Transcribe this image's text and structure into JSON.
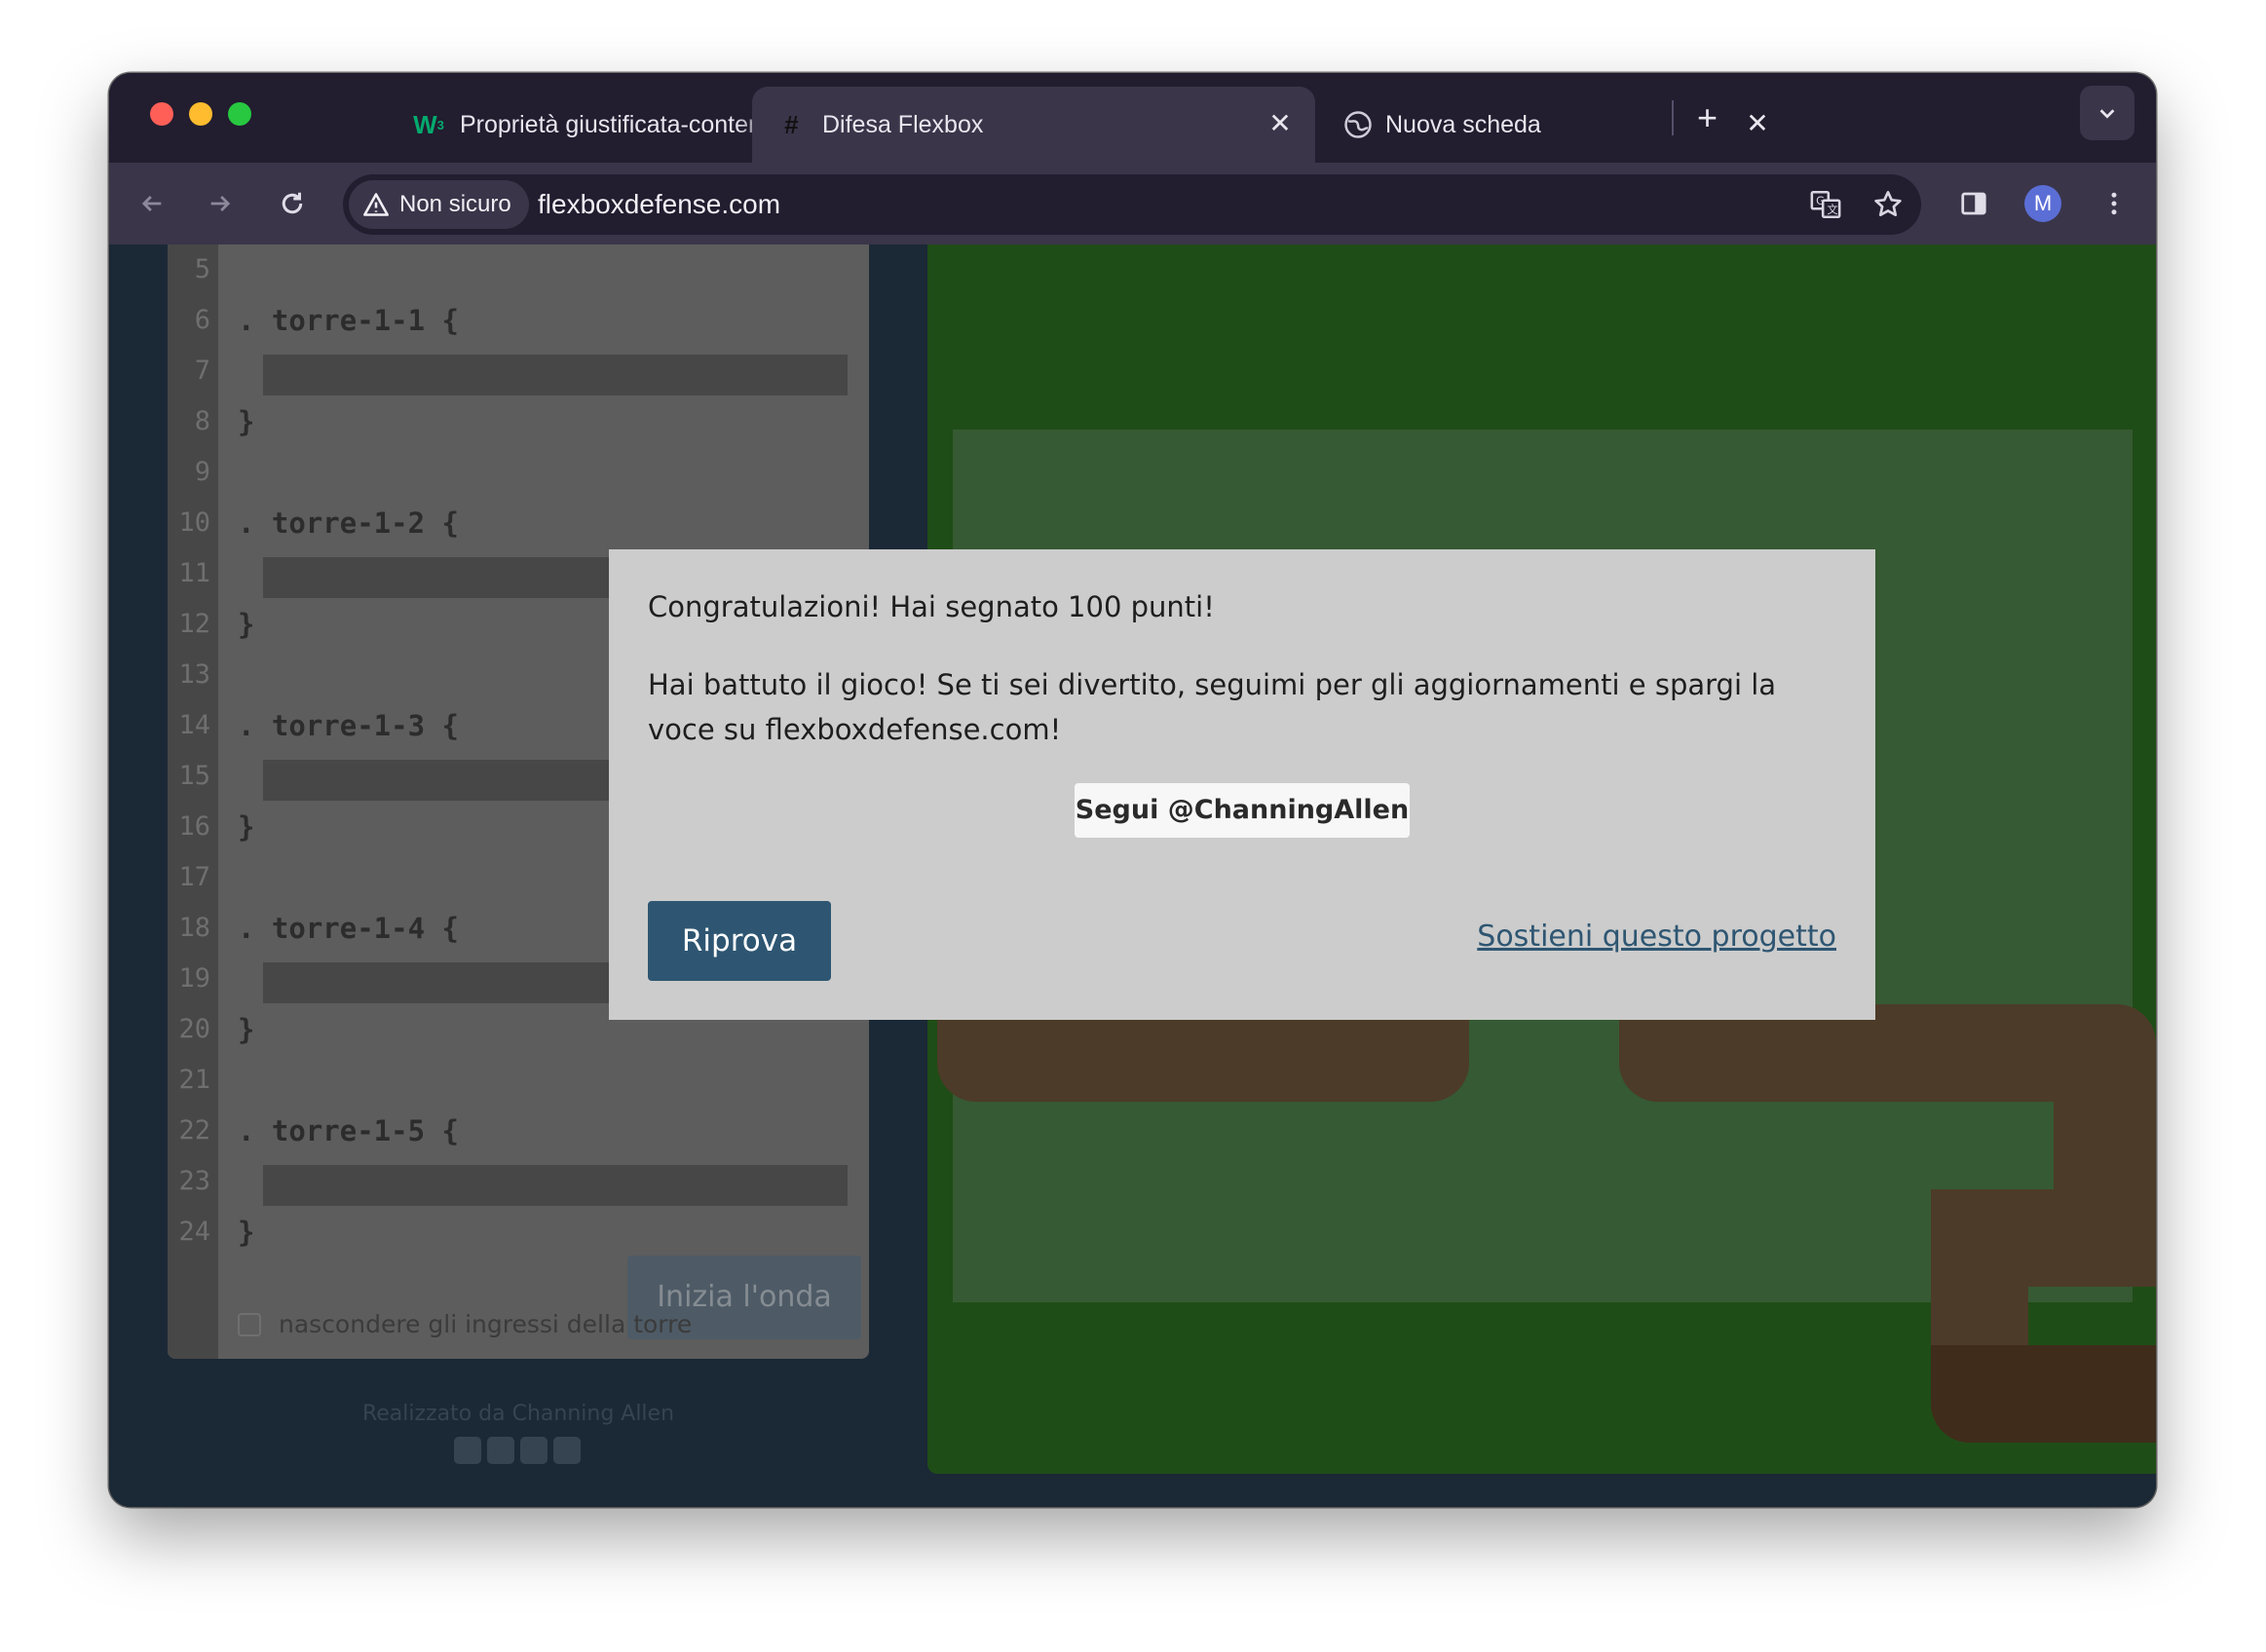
{
  "browser": {
    "tabs": [
      {
        "title": "Proprietà giustificata-contenuto",
        "favicon": "w3schools-icon",
        "active": false
      },
      {
        "title": "Difesa Flexbox",
        "favicon": "hash-icon",
        "active": true
      },
      {
        "title": "Nuova scheda",
        "favicon": "globe-icon",
        "active": false
      }
    ],
    "security_badge": "Non sicuro",
    "url": "flexboxdefense.com",
    "avatar_initial": "M"
  },
  "editor": {
    "lines": [
      {
        "n": "5",
        "text": ""
      },
      {
        "n": "6",
        "text": ". torre-1-1 {"
      },
      {
        "n": "7",
        "text": ""
      },
      {
        "n": "8",
        "text": "}"
      },
      {
        "n": "9",
        "text": ""
      },
      {
        "n": "10",
        "text": ". torre-1-2 {"
      },
      {
        "n": "11",
        "text": ""
      },
      {
        "n": "12",
        "text": "}"
      },
      {
        "n": "13",
        "text": ""
      },
      {
        "n": "14",
        "text": ". torre-1-3 {"
      },
      {
        "n": "15",
        "text": ""
      },
      {
        "n": "16",
        "text": "}"
      },
      {
        "n": "17",
        "text": ""
      },
      {
        "n": "18",
        "text": ". torre-1-4 {"
      },
      {
        "n": "19",
        "text": ""
      },
      {
        "n": "20",
        "text": "}"
      },
      {
        "n": "21",
        "text": ""
      },
      {
        "n": "22",
        "text": ". torre-1-5 {"
      },
      {
        "n": "23",
        "text": ""
      },
      {
        "n": "24",
        "text": "}"
      }
    ],
    "start_wave_label": "Inizia l'onda",
    "hide_entrances_label": "nascondere gli ingressi della torre",
    "credits": "Realizzato da Channing Allen"
  },
  "modal": {
    "congrats": "Congratulazioni! Hai segnato 100 punti!",
    "message": "Hai battuto il gioco! Se ti sei divertito, seguimi per gli aggiornamenti e spargi la voce su flexboxdefense.com!",
    "follow_label": "Segui @ChanningAllen",
    "retry_label": "Riprova",
    "support_label": "Sostieni questo progetto"
  },
  "colors": {
    "modal_bg": "#cccccc",
    "primary": "#2e5672",
    "board": "#1f4d17",
    "path": "#4c3b28"
  }
}
